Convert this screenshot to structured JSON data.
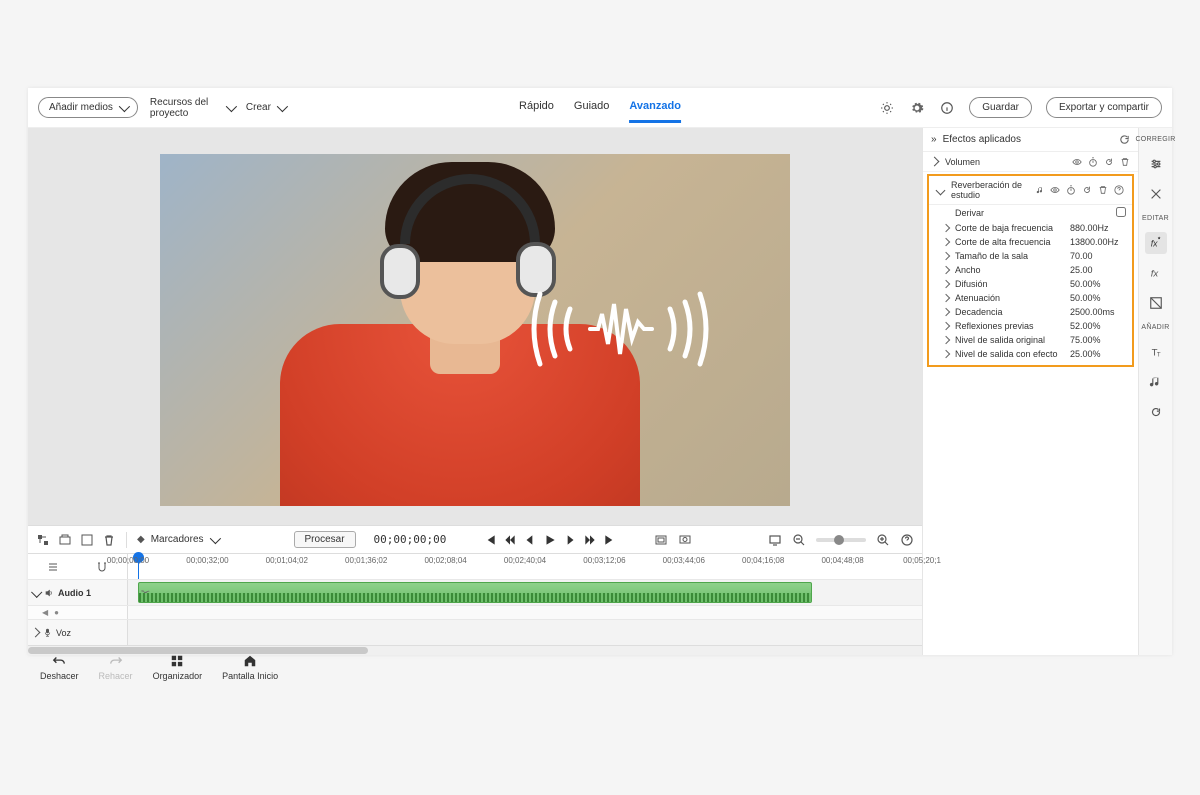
{
  "topbar": {
    "add_media": "Añadir medios",
    "project_resources": "Recursos del proyecto",
    "create": "Crear",
    "tabs": {
      "quick": "Rápido",
      "guided": "Guiado",
      "advanced": "Avanzado"
    },
    "save": "Guardar",
    "export": "Exportar y compartir"
  },
  "transport": {
    "process": "Procesar",
    "timecode": "00;00;00;00",
    "markers": "Marcadores"
  },
  "ruler": {
    "ticks": [
      "00;00;00;00",
      "00;00;32;00",
      "00;01;04;02",
      "00;01;36;02",
      "00;02;08;04",
      "00;02;40;04",
      "00;03;12;06",
      "00;03;44;06",
      "00;04;16;08",
      "00;04;48;08",
      "00;05;20;1"
    ]
  },
  "tracks": {
    "audio1": "Audio 1",
    "voice": "Voz"
  },
  "history": {
    "undo": "Deshacer",
    "redo": "Rehacer",
    "organizer": "Organizador",
    "home": "Pantalla Inicio"
  },
  "effects_panel": {
    "title": "Efectos aplicados",
    "volume": "Volumen",
    "reverb": "Reverberación de estudio",
    "params": [
      {
        "label": "Derivar",
        "value": "",
        "checkbox": true
      },
      {
        "label": "Corte de baja frecuencia",
        "value": "880.00Hz"
      },
      {
        "label": "Corte de alta frecuencia",
        "value": "13800.00Hz"
      },
      {
        "label": "Tamaño de la sala",
        "value": "70.00"
      },
      {
        "label": "Ancho",
        "value": "25.00"
      },
      {
        "label": "Difusión",
        "value": "50.00%"
      },
      {
        "label": "Atenuación",
        "value": "50.00%"
      },
      {
        "label": "Decadencia",
        "value": "2500.00ms"
      },
      {
        "label": "Reflexiones previas",
        "value": "52.00%"
      },
      {
        "label": "Nivel de salida original",
        "value": "75.00%"
      },
      {
        "label": "Nivel de salida con efecto",
        "value": "25.00%"
      }
    ]
  },
  "vstrip": {
    "correct": "CORREGIR",
    "edit": "EDITAR",
    "add": "AÑADIR"
  }
}
